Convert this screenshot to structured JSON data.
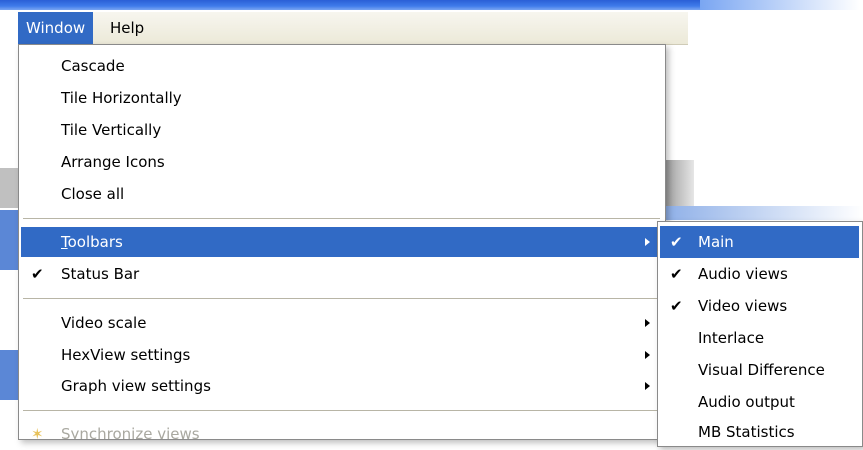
{
  "menubar": {
    "items": [
      {
        "label": "Window",
        "active": true
      },
      {
        "label": "Help",
        "active": false
      }
    ]
  },
  "window_menu": {
    "group1": [
      "Cascade",
      "Tile Horizontally",
      "Tile Vertically",
      "Arrange Icons",
      "Close all"
    ],
    "toolbars": {
      "label": "Toolbars",
      "highlighted": true,
      "has_submenu": true
    },
    "status_bar": {
      "label": "Status Bar",
      "checked": true
    },
    "group3": [
      {
        "label": "Video scale",
        "has_submenu": true
      },
      {
        "label": "HexView settings",
        "has_submenu": true
      },
      {
        "label": "Graph view settings",
        "has_submenu": true
      }
    ],
    "partial_item": "Synchronize views"
  },
  "toolbars_submenu": {
    "items": [
      {
        "label": "Main",
        "checked": true,
        "highlighted": true
      },
      {
        "label": "Audio views",
        "checked": true
      },
      {
        "label": "Video views",
        "checked": true
      },
      {
        "label": "Interlace",
        "checked": false
      },
      {
        "label": "Visual Difference",
        "checked": false
      },
      {
        "label": "Audio output",
        "checked": false
      },
      {
        "label": "MB Statistics",
        "checked": false
      }
    ]
  },
  "icons": {
    "check": "check-icon",
    "submenu_arrow": "submenu-arrow-icon"
  },
  "colors": {
    "highlight": "#316ac5",
    "menubar": "#ece9d8",
    "titlebar": "#3f7bea"
  }
}
